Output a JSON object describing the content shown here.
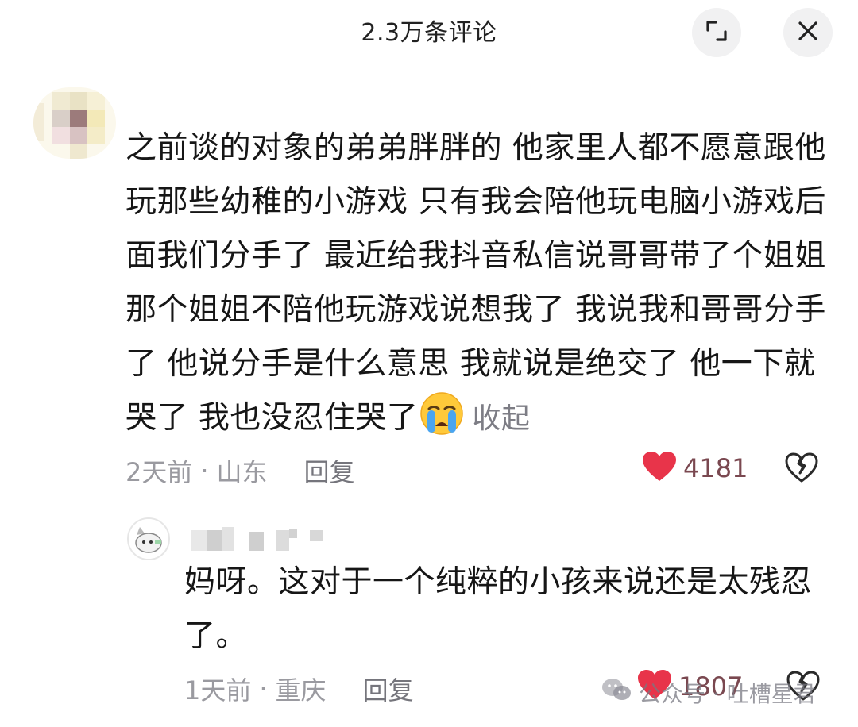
{
  "header": {
    "title": "2.3万条评论",
    "expand_icon": "expand-icon",
    "close_icon": "close-icon"
  },
  "comment": {
    "text": "之前谈的对象的弟弟胖胖的 他家里人都不愿意跟他玩那些幼稚的小游戏 只有我会陪他玩电脑小游戏后面我们分手了 最近给我抖音私信说哥哥带了个姐姐 那个姐姐不陪他玩游戏说想我了 我说我和哥哥分手了 他说分手是什么意思 我就说是绝交了 他一下就哭了 我也没忍住哭了",
    "emoji": "crying-face-emoji",
    "collapse_label": "收起",
    "time": "2天前",
    "separator": "·",
    "location": "山东",
    "reply_label": "回复",
    "likes": "4181"
  },
  "reply": {
    "text": "妈呀。这对于一个纯粹的小孩来说还是太残忍了。",
    "time": "1天前",
    "separator": "·",
    "location": "重庆",
    "reply_label": "回复",
    "likes": "1807"
  },
  "watermark": {
    "text": "公众号 · 吐槽星君"
  },
  "colors": {
    "heart": "#e8344a",
    "text": "#161616",
    "meta": "#9a9aa0"
  }
}
